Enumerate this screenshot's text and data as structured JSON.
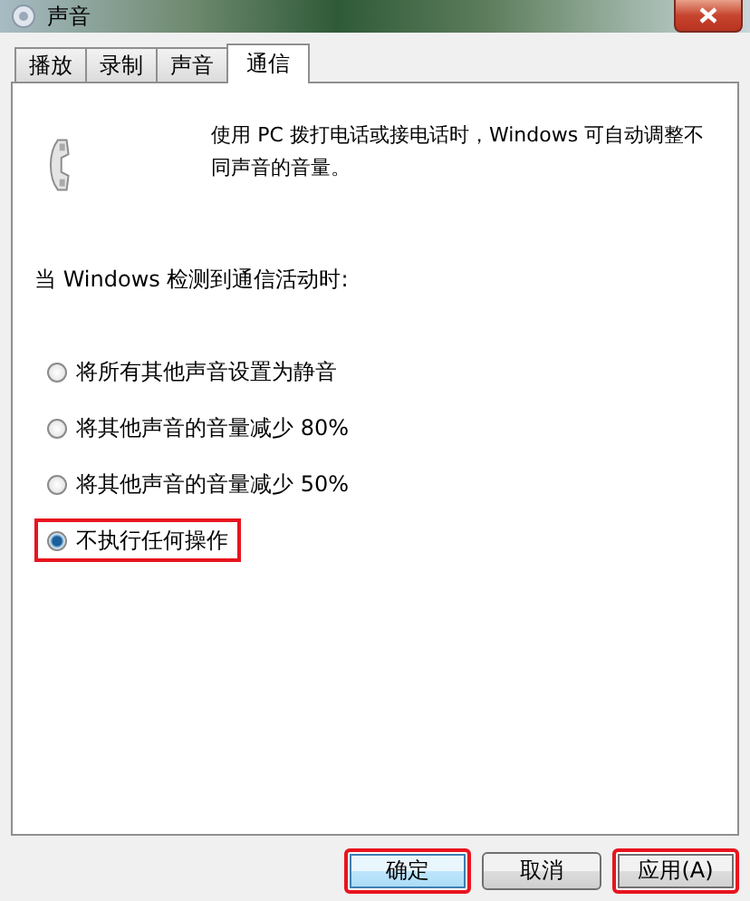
{
  "window": {
    "title": "声音"
  },
  "tabs": [
    {
      "label": "播放",
      "selected": false
    },
    {
      "label": "录制",
      "selected": false
    },
    {
      "label": "声音",
      "selected": false
    },
    {
      "label": "通信",
      "selected": true
    }
  ],
  "description": "使用 PC 拨打电话或接电话时，Windows 可自动调整不同声音的音量。",
  "prompt": "当 Windows 检测到通信活动时:",
  "options": [
    {
      "label": "将所有其他声音设置为静音",
      "selected": false,
      "highlighted": false
    },
    {
      "label": "将其他声音的音量减少 80%",
      "selected": false,
      "highlighted": false
    },
    {
      "label": "将其他声音的音量减少 50%",
      "selected": false,
      "highlighted": false
    },
    {
      "label": "不执行任何操作",
      "selected": true,
      "highlighted": true
    }
  ],
  "buttons": [
    {
      "label": "确定",
      "highlighted": true,
      "default": true
    },
    {
      "label": "取消",
      "highlighted": false,
      "default": false
    },
    {
      "label": "应用(A)",
      "highlighted": true,
      "default": false
    }
  ]
}
